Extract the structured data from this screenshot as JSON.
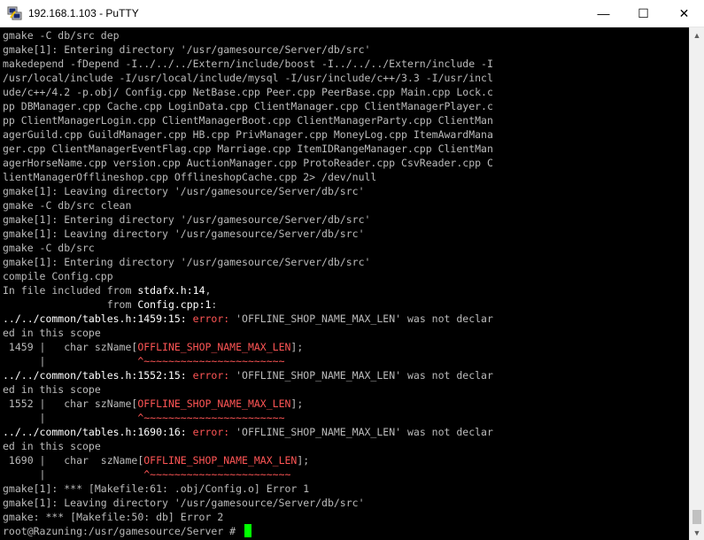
{
  "window": {
    "title": "192.168.1.103 - PuTTY",
    "icon": "putty-icon",
    "min_glyph": "—",
    "max_glyph": "☐",
    "close_glyph": "✕"
  },
  "colors": {
    "terminal_bg": "#000000",
    "terminal_fg": "#bbbbbb",
    "error": "#ff5555",
    "cursor": "#00ff00"
  },
  "terminal": {
    "lines": [
      {
        "text": "gmake -C db/src dep"
      },
      {
        "text": "gmake[1]: Entering directory '/usr/gamesource/Server/db/src'"
      },
      {
        "text": "makedepend -fDepend -I../../../Extern/include/boost -I../../../Extern/include -I"
      },
      {
        "text": "/usr/local/include -I/usr/local/include/mysql -I/usr/include/c++/3.3 -I/usr/incl"
      },
      {
        "text": "ude/c++/4.2 -p.obj/ Config.cpp NetBase.cpp Peer.cpp PeerBase.cpp Main.cpp Lock.c"
      },
      {
        "text": "pp DBManager.cpp Cache.cpp LoginData.cpp ClientManager.cpp ClientManagerPlayer.c"
      },
      {
        "text": "pp ClientManagerLogin.cpp ClientManagerBoot.cpp ClientManagerParty.cpp ClientMan"
      },
      {
        "text": "agerGuild.cpp GuildManager.cpp HB.cpp PrivManager.cpp MoneyLog.cpp ItemAwardMana"
      },
      {
        "text": "ger.cpp ClientManagerEventFlag.cpp Marriage.cpp ItemIDRangeManager.cpp ClientMan"
      },
      {
        "text": "agerHorseName.cpp version.cpp AuctionManager.cpp ProtoReader.cpp CsvReader.cpp C"
      },
      {
        "text": "lientManagerOfflineshop.cpp OfflineshopCache.cpp 2> /dev/null"
      },
      {
        "text": "gmake[1]: Leaving directory '/usr/gamesource/Server/db/src'"
      },
      {
        "text": "gmake -C db/src clean"
      },
      {
        "text": "gmake[1]: Entering directory '/usr/gamesource/Server/db/src'"
      },
      {
        "text": "gmake[1]: Leaving directory '/usr/gamesource/Server/db/src'"
      },
      {
        "text": "gmake -C db/src"
      },
      {
        "text": "gmake[1]: Entering directory '/usr/gamesource/Server/db/src'"
      },
      {
        "text": "compile Config.cpp"
      },
      {
        "text": "In file included from ",
        "hi": "stdafx.h:14",
        "rest": ","
      },
      {
        "text": "                 from ",
        "hi": "Config.cpp:1",
        "rest": ":"
      },
      {
        "hi": "../../common/tables.h:1459:15:",
        "err": " error: ",
        "rest": "'OFFLINE_SHOP_NAME_MAX_LEN' was not declar"
      },
      {
        "text": "ed in this scope"
      },
      {
        "text": " 1459 |   char szName[",
        "red": "OFFLINE_SHOP_NAME_MAX_LEN",
        "rest": "];"
      },
      {
        "text": "      |               ",
        "red": "^~~~~~~~~~~~~~~~~~~~~~~~"
      },
      {
        "hi": "../../common/tables.h:1552:15:",
        "err": " error: ",
        "rest": "'OFFLINE_SHOP_NAME_MAX_LEN' was not declar"
      },
      {
        "text": "ed in this scope"
      },
      {
        "text": " 1552 |   char szName[",
        "red": "OFFLINE_SHOP_NAME_MAX_LEN",
        "rest": "];"
      },
      {
        "text": "      |               ",
        "red": "^~~~~~~~~~~~~~~~~~~~~~~~"
      },
      {
        "hi": "../../common/tables.h:1690:16:",
        "err": " error: ",
        "rest": "'OFFLINE_SHOP_NAME_MAX_LEN' was not declar"
      },
      {
        "text": "ed in this scope"
      },
      {
        "text": " 1690 |   char  szName[",
        "red": "OFFLINE_SHOP_NAME_MAX_LEN",
        "rest": "];"
      },
      {
        "text": "      |                ",
        "red": "^~~~~~~~~~~~~~~~~~~~~~~~"
      },
      {
        "text": "gmake[1]: *** [Makefile:61: .obj/Config.o] Error 1"
      },
      {
        "text": "gmake[1]: Leaving directory '/usr/gamesource/Server/db/src'"
      },
      {
        "text": "gmake: *** [Makefile:50: db] Error 2"
      },
      {
        "text": "root@Razuning:/usr/gamesource/Server # ",
        "cursor": true
      }
    ]
  },
  "scrollbar": {
    "up_glyph": "▲",
    "down_glyph": "▼"
  }
}
